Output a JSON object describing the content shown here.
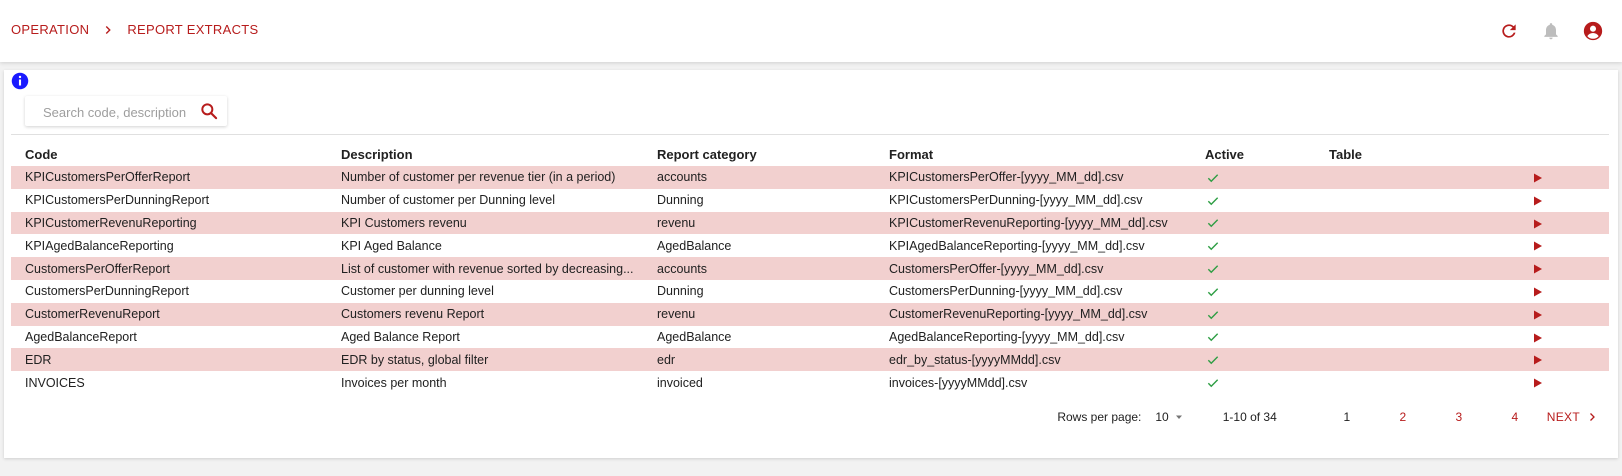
{
  "colors": {
    "accent": "#b71c1c",
    "row_highlight": "#f2d0cf",
    "check": "#2e9e44",
    "info": "#1a1aff"
  },
  "breadcrumb": {
    "items": [
      "OPERATION",
      "REPORT EXTRACTS"
    ]
  },
  "header_icons": [
    "refresh-icon",
    "bell-icon",
    "account-icon"
  ],
  "search": {
    "placeholder": "Search code, description",
    "value": ""
  },
  "table": {
    "columns": [
      "Code",
      "Description",
      "Report category",
      "Format",
      "Active",
      "Table"
    ],
    "rows": [
      {
        "code": "KPICustomersPerOfferReport",
        "description": "Number of customer per revenue tier (in a period)",
        "category": "accounts",
        "format": "KPICustomersPerOffer-[yyyy_MM_dd].csv",
        "active": true
      },
      {
        "code": "KPICustomersPerDunningReport",
        "description": "Number of customer per Dunning level",
        "category": "Dunning",
        "format": "KPICustomersPerDunning-[yyyy_MM_dd].csv",
        "active": true
      },
      {
        "code": "KPICustomerRevenuReporting",
        "description": "KPI Customers revenu",
        "category": "revenu",
        "format": "KPICustomerRevenuReporting-[yyyy_MM_dd].csv",
        "active": true
      },
      {
        "code": "KPIAgedBalanceReporting",
        "description": "KPI Aged Balance",
        "category": "AgedBalance",
        "format": "KPIAgedBalanceReporting-[yyyy_MM_dd].csv",
        "active": true
      },
      {
        "code": "CustomersPerOfferReport",
        "description": "List of customer with revenue sorted by decreasing...",
        "category": "accounts",
        "format": "CustomersPerOffer-[yyyy_MM_dd].csv",
        "active": true
      },
      {
        "code": "CustomersPerDunningReport",
        "description": "Customer per dunning level",
        "category": "Dunning",
        "format": "CustomersPerDunning-[yyyy_MM_dd].csv",
        "active": true
      },
      {
        "code": "CustomerRevenuReport",
        "description": "Customers revenu Report",
        "category": "revenu",
        "format": "CustomerRevenuReporting-[yyyy_MM_dd].csv",
        "active": true
      },
      {
        "code": "AgedBalanceReport",
        "description": "Aged Balance Report",
        "category": "AgedBalance",
        "format": "AgedBalanceReporting-[yyyy_MM_dd].csv",
        "active": true
      },
      {
        "code": "EDR",
        "description": "EDR by status, global filter",
        "category": "edr",
        "format": "edr_by_status-[yyyyMMdd].csv",
        "active": true
      },
      {
        "code": "INVOICES",
        "description": "Invoices per month",
        "category": "invoiced",
        "format": "invoices-[yyyyMMdd].csv",
        "active": true
      }
    ]
  },
  "pagination": {
    "rows_per_page_label": "Rows per page:",
    "rows_per_page": "10",
    "range": "1-10 of 34",
    "pages": [
      "1",
      "2",
      "3",
      "4"
    ],
    "current_page": "1",
    "next_label": "NEXT"
  }
}
